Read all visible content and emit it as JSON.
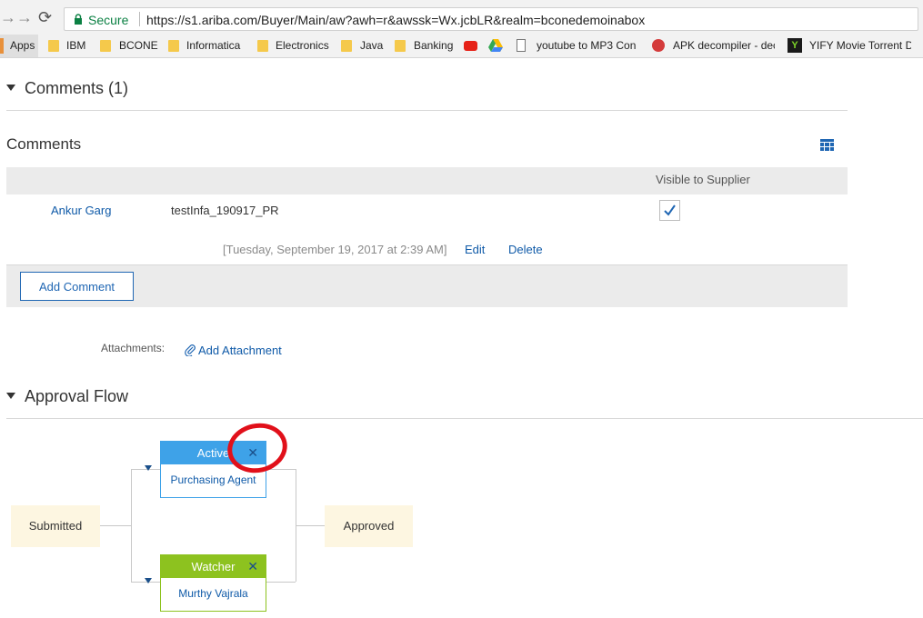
{
  "browser": {
    "secure_label": "Secure",
    "url": "https://s1.ariba.com/Buyer/Main/aw?awh=r&awssk=Wx.jcbLR&realm=bconedemoinabox",
    "bookmarks": {
      "apps": "Apps",
      "ibm": "IBM",
      "bcone": "BCONE",
      "informatica": "Informatica",
      "electronics": "Electronics",
      "java": "Java",
      "banking": "Banking",
      "youtube_mp3": "youtube to MP3 Con",
      "apk": "APK decompiler - dec",
      "yify": "YIFY Movie Torrent D"
    }
  },
  "comments_section": {
    "heading": "Comments (1)",
    "title": "Comments",
    "column_visible": "Visible to Supplier",
    "rows": [
      {
        "author": "Ankur Garg",
        "text": "testInfa_190917_PR",
        "timestamp": "[Tuesday, September 19, 2017 at 2:39 AM]",
        "edit": "Edit",
        "delete": "Delete",
        "visible_to_supplier": true
      }
    ],
    "add_comment": "Add Comment",
    "attachments_label": "Attachments:",
    "add_attachment": "Add Attachment"
  },
  "approval_flow": {
    "heading": "Approval Flow",
    "start": "Submitted",
    "end": "Approved",
    "nodes": [
      {
        "status": "Active",
        "assignee": "Purchasing Agent",
        "color": "#3ea2e8"
      },
      {
        "status": "Watcher",
        "assignee": "Murthy Vajrala",
        "color": "#8dc21f"
      }
    ]
  },
  "colors": {
    "link": "#0f5aa8",
    "secure": "#0b8043",
    "active": "#3ea2e8",
    "watcher": "#8dc21f",
    "highlight": "#e1101a"
  }
}
